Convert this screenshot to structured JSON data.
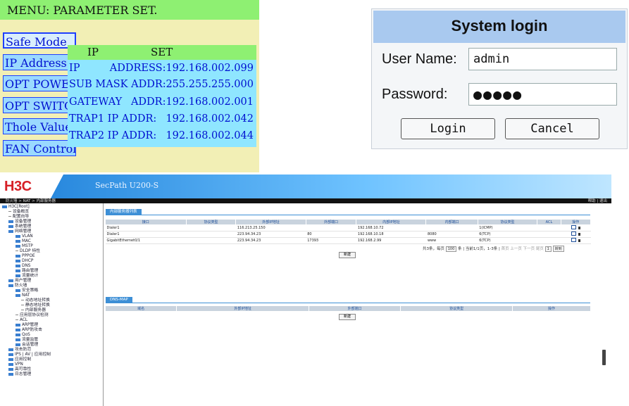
{
  "lcd": {
    "title": "MENU: PARAMETER SET.",
    "menu": [
      "Safe Mode",
      "IP Address",
      "OPT POWER",
      "OPT SWITCH",
      "Thole Value",
      "FAN Control"
    ],
    "ipset": {
      "head_left": "IP",
      "head_right": "SET",
      "rows": [
        {
          "key": "IP",
          "value": "ADDRESS:192.168.002.099"
        },
        {
          "key": "SUB MASK ADDR:",
          "value": "255.255.255.000"
        },
        {
          "key": "GATEWAY",
          "value": "ADDR:192.168.002.001"
        },
        {
          "key": "TRAP1 IP ADDR:",
          "value": "192.168.002.042"
        },
        {
          "key": "TRAP2 IP ADDR:",
          "value": "192.168.002.044"
        }
      ]
    }
  },
  "login": {
    "title": "System login",
    "user_label": "User Name:",
    "user_value": "admin",
    "pass_label": "Password:",
    "pass_value": "●●●●●",
    "login_btn": "Login",
    "cancel_btn": "Cancel"
  },
  "h3c": {
    "logo": "H3C",
    "product": "SecPath U200-S",
    "breadcrumb": "防火墙 > NAT > 内部服务器",
    "top_right": "帮助 | 退出",
    "tree": [
      "H3C[Root]",
      "设备概览",
      "配置向导",
      "设备管理",
      "系统管理",
      "网络管理",
      "VLAN",
      "MAC",
      "MSTP",
      "DLDP 特性",
      "PPPOE",
      "DHCP",
      "DNS",
      "路由管理",
      "流量统计",
      "用户管理",
      "防火墙",
      "安全策略",
      "NAT",
      "动态地址转换",
      "静态地址转换",
      "内部服务器",
      "应用层协议检测",
      "ACL",
      "ARP管理",
      "ARP防攻击",
      "QoS",
      "流量监管",
      "会话管理",
      "攻击防范",
      "IPS | AV | 应用控制",
      "应用控制",
      "VPN",
      "高可靠性",
      "日志管理"
    ],
    "tab1": "内部服务器列表",
    "table1_headers": [
      "接口",
      "协议类型",
      "外部IP地址",
      "外部端口",
      "内部IP地址",
      "内部端口",
      "协议类型",
      "ACL",
      "操作"
    ],
    "table1_rows": [
      [
        "Dialer1",
        "",
        "116.213.25.150",
        "",
        "192.168.10.72",
        "",
        "1(ICMP)",
        "",
        ""
      ],
      [
        "Dialer1",
        "",
        "223.94.34.23",
        "80",
        "192.168.10.18",
        "8080",
        "6(TCP)",
        "",
        ""
      ],
      [
        "GigabitEthernet0/1",
        "",
        "223.94.34.23",
        "17393",
        "192.168.2.99",
        "www",
        "6(TCP)",
        "",
        ""
      ]
    ],
    "pager_text": "共3条，每页",
    "pager_size": "100",
    "pager_info": "条 | 当前1/1页，1-3条 |",
    "pager_first": "首页",
    "pager_prev": "上一页",
    "pager_next": "下一页",
    "pager_last": "尾页",
    "pager_page": "1",
    "pager_go": "转到",
    "new_btn": "新建",
    "tab2": "DNS-MAP",
    "table2_headers": [
      "域名",
      "外部IP地址",
      "外部端口",
      "协议类型",
      "操作"
    ],
    "new_btn2": "新建"
  }
}
